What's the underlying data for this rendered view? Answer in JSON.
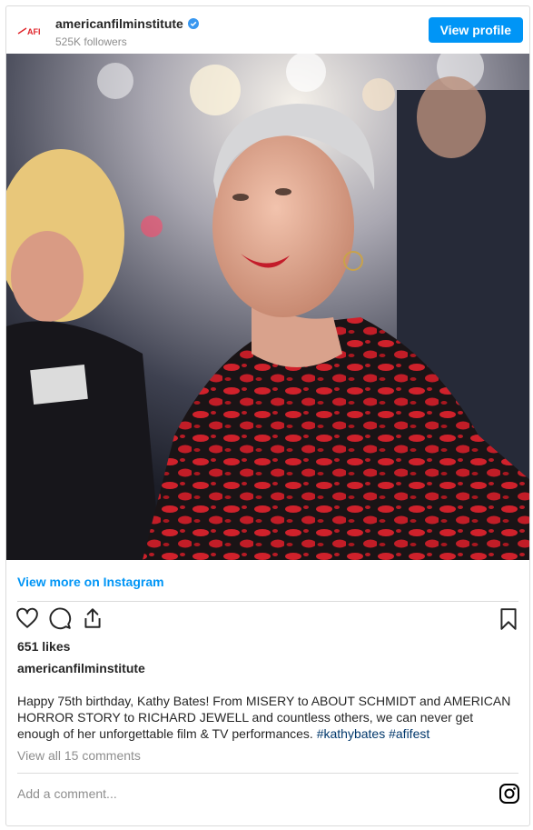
{
  "header": {
    "avatar_text": "AFI",
    "username": "americanfilminstitute",
    "followers": "525K followers",
    "view_profile_label": "View profile"
  },
  "post": {
    "view_more_label": "View more on Instagram",
    "likes": "651 likes",
    "caption_username": "americanfilminstitute",
    "caption_text": "Happy 75th birthday, Kathy Bates! From MISERY to ABOUT SCHMIDT and AMERICAN HORROR STORY to RICHARD JEWELL and countless others, we can never get enough of her unforgettable film & TV performances. ",
    "hashtags": [
      "#kathybates",
      "#afifest"
    ],
    "view_comments_label": "View all 15 comments",
    "add_comment_placeholder": "Add a comment..."
  },
  "icons": {
    "like": "heart-icon",
    "comment": "comment-icon",
    "share": "share-icon",
    "save": "bookmark-icon",
    "instagram": "instagram-icon",
    "verified": "verified-badge-icon"
  },
  "colors": {
    "accent": "#0095f6",
    "hashtag": "#00376b",
    "muted": "#8e8e8e",
    "brand_red": "#e0242a"
  }
}
